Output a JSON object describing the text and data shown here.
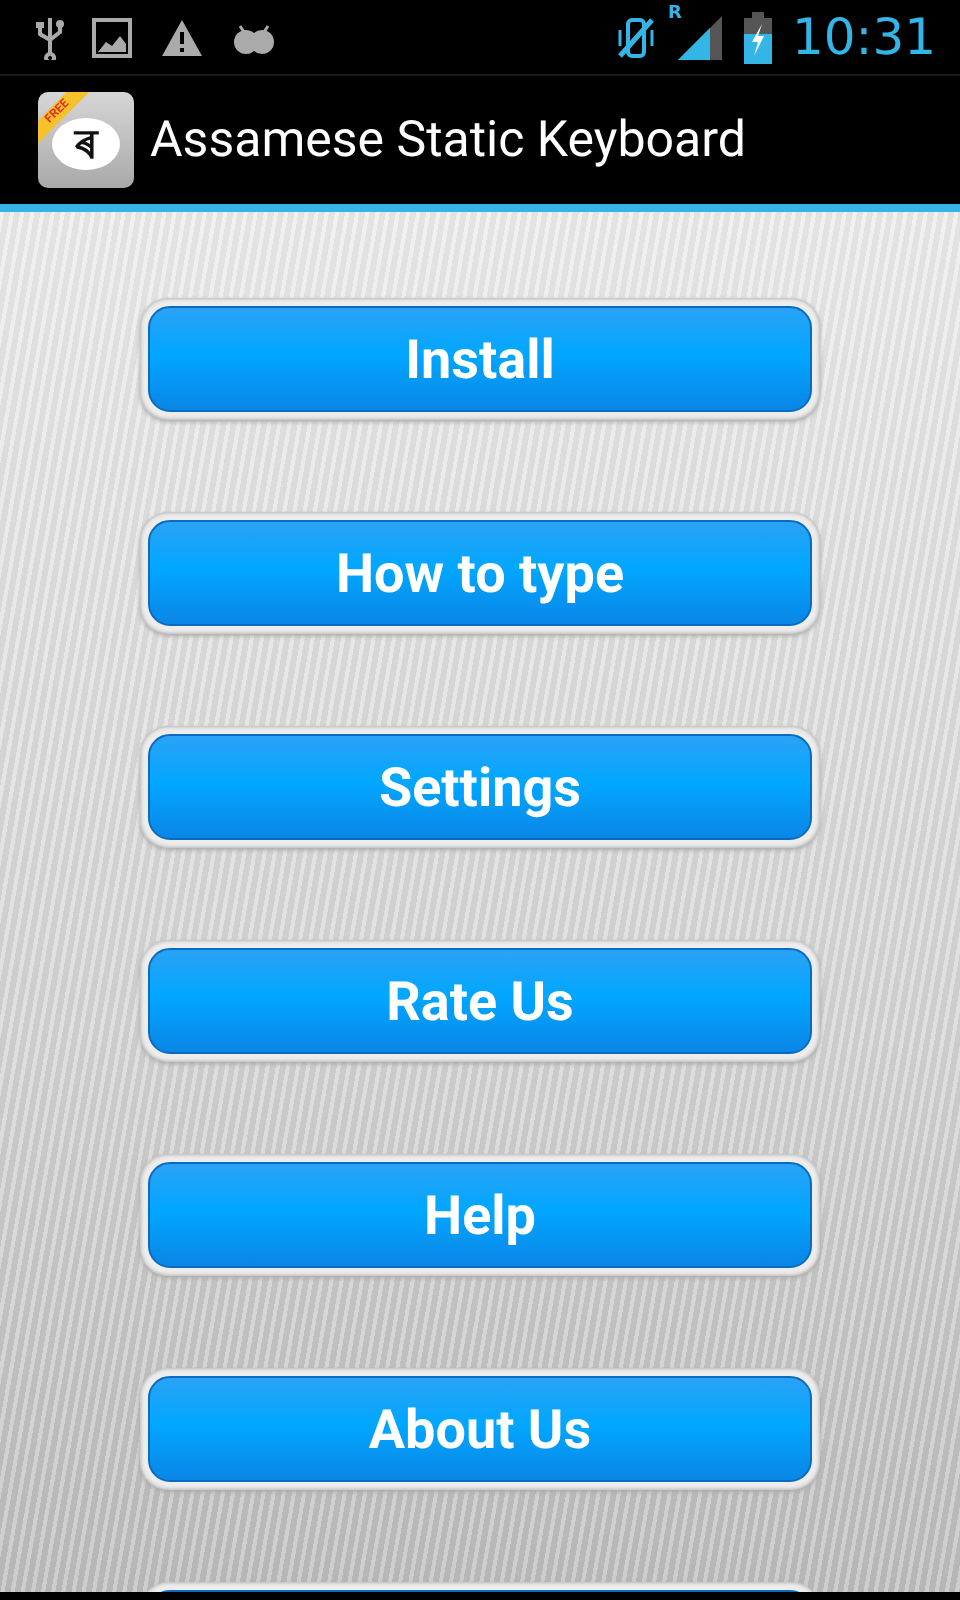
{
  "status_bar": {
    "roaming": "R",
    "time": "10:31"
  },
  "action_bar": {
    "icon_badge": "FREE",
    "icon_glyph": "ৰ",
    "title": "Assamese Static Keyboard"
  },
  "buttons": [
    {
      "kind": "label",
      "label": "Install"
    },
    {
      "kind": "label",
      "label": "How to type"
    },
    {
      "kind": "label",
      "label": "Settings"
    },
    {
      "kind": "label",
      "label": "Rate Us"
    },
    {
      "kind": "label",
      "label": "Help"
    },
    {
      "kind": "label",
      "label": "About Us"
    },
    {
      "kind": "cut"
    }
  ]
}
